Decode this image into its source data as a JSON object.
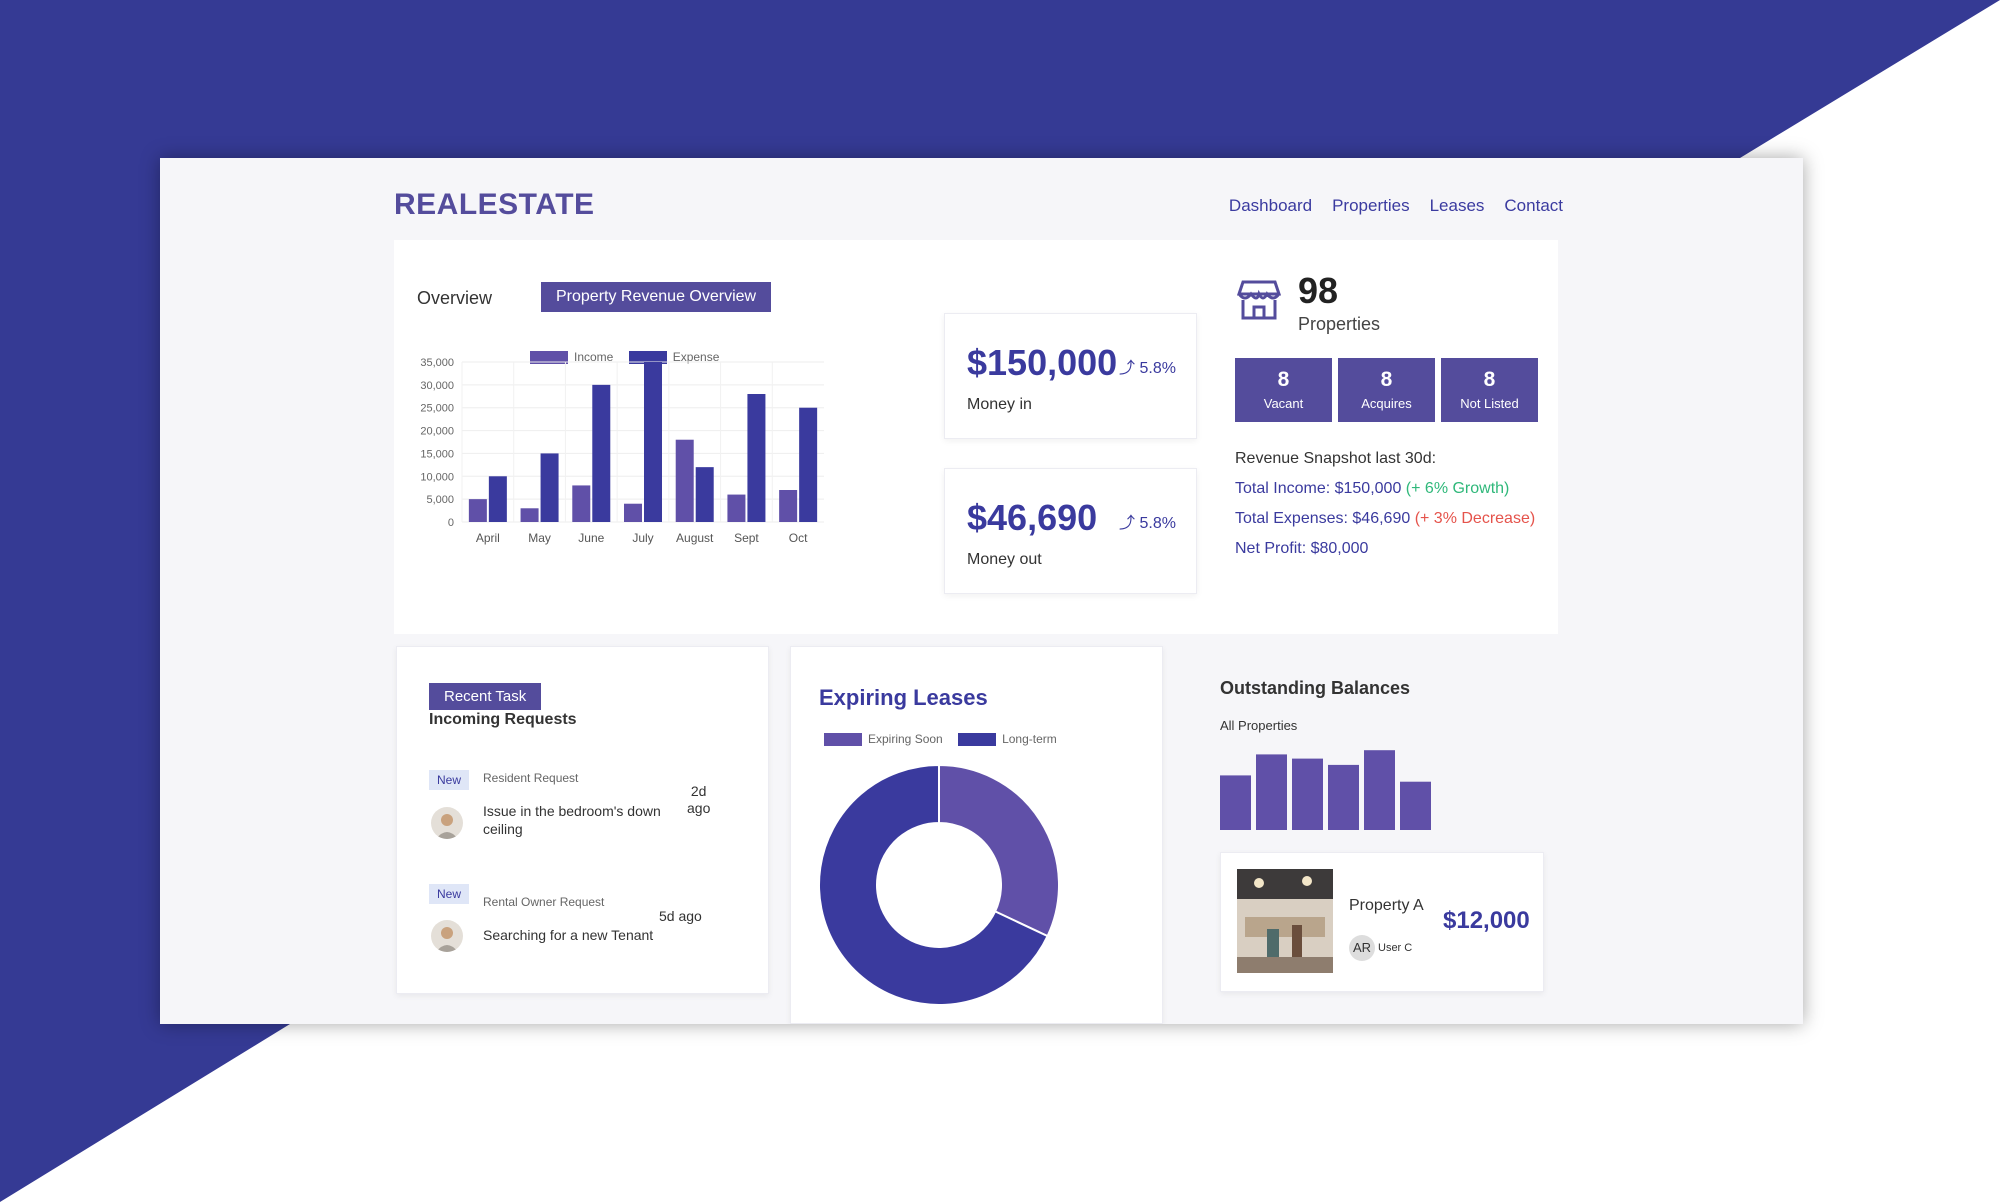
{
  "app": {
    "brand": "REALESTATE"
  },
  "nav": {
    "items": [
      "Dashboard",
      "Properties",
      "Leases",
      "Contact"
    ]
  },
  "colors": {
    "primary": "#544c9c",
    "accent": "#3a3a9e",
    "background_shape": "#353a94",
    "income": "#6050a8",
    "expense": "#3a3a9e",
    "growth": "#2fb87a",
    "decrease": "#e5534b"
  },
  "overview": {
    "label": "Overview",
    "tab": "Property Revenue Overview"
  },
  "chart_data": [
    {
      "type": "bar",
      "categories": [
        "April",
        "May",
        "June",
        "July",
        "August",
        "Sept",
        "Oct"
      ],
      "series": [
        {
          "name": "Income",
          "values": [
            5000,
            3000,
            8000,
            4000,
            18000,
            6000,
            7000
          ]
        },
        {
          "name": "Expense",
          "values": [
            10000,
            15000,
            30000,
            35000,
            12000,
            28000,
            25000
          ]
        }
      ],
      "yticks": [
        "35,000",
        "30,000",
        "25,000",
        "20,000",
        "15,000",
        "10,000",
        "5,000",
        "0"
      ],
      "ylim": [
        0,
        35000
      ],
      "grid": true,
      "legend": "top"
    },
    {
      "type": "pie",
      "subtype": "donut",
      "labels": [
        "Expiring Soon",
        "Long-term"
      ],
      "values": [
        32,
        68
      ],
      "legend": "top-left"
    },
    {
      "type": "bar",
      "values": [
        26,
        36,
        34,
        31,
        38,
        23
      ],
      "legend": "none"
    }
  ],
  "money_in": {
    "value": "$150,000",
    "pct": "5.8%",
    "label": "Money in"
  },
  "money_out": {
    "value": "$46,690",
    "pct": "5.8%",
    "label": "Money out"
  },
  "properties": {
    "count": "98",
    "label": "Properties",
    "icon": "store-icon",
    "stats": [
      {
        "n": "8",
        "label": "Vacant"
      },
      {
        "n": "8",
        "label": "Acquires"
      },
      {
        "n": "8",
        "label": "Not Listed"
      }
    ]
  },
  "snapshot": {
    "title": "Revenue Snapshot last 30d:",
    "income": "Total Income: $150,000",
    "income_note": "(+ 6% Growth)",
    "expenses": "Total Expenses: $46,690",
    "expenses_note": "(+ 3% Decrease)",
    "net": "Net Profit: $80,000"
  },
  "tasks": {
    "tab": "Recent Task",
    "title": "Incoming Requests",
    "items": [
      {
        "badge": "New",
        "type": "Resident Request",
        "text": "Issue in the bedroom's down ceiling",
        "time_a": "2d",
        "time_b": "ago"
      },
      {
        "badge": "New",
        "type": "Rental Owner Request",
        "text": "Searching for a new Tenant",
        "time_a": "5d ago",
        "time_b": ""
      }
    ]
  },
  "leases": {
    "title": "Expiring Leases",
    "legend": [
      "Expiring Soon",
      "Long-term"
    ]
  },
  "balances": {
    "title": "Outstanding Balances",
    "subtitle": "All Properties",
    "property": {
      "name": "Property A",
      "amount": "$12,000",
      "initials": "AR",
      "user": "User C"
    }
  }
}
